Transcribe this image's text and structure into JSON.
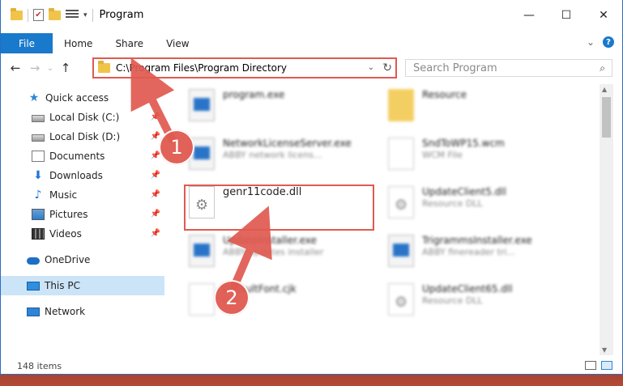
{
  "window": {
    "title": "Program",
    "controls": {
      "minimize": "—",
      "maximize": "☐",
      "close": "✕"
    }
  },
  "ribbon": {
    "tabs": [
      "File",
      "Home",
      "Share",
      "View"
    ],
    "help": "?",
    "expand": "⌄"
  },
  "nav": {
    "back": "←",
    "forward": "→",
    "up": "↑",
    "recent": "⌄",
    "address": "C:\\Program Files\\Program Directory",
    "refresh": "↻",
    "search_placeholder": "Search Program",
    "search_icon": "🔍"
  },
  "sidebar": {
    "items": [
      {
        "label": "Quick access",
        "icon": "star-icon",
        "pinned": false
      },
      {
        "label": "Local Disk (C:)",
        "icon": "drive-icon",
        "pinned": true
      },
      {
        "label": "Local Disk (D:)",
        "icon": "drive-icon",
        "pinned": true
      },
      {
        "label": "Documents",
        "icon": "documents-icon",
        "pinned": true
      },
      {
        "label": "Downloads",
        "icon": "downloads-icon",
        "pinned": true
      },
      {
        "label": "Music",
        "icon": "music-icon",
        "pinned": true
      },
      {
        "label": "Pictures",
        "icon": "pictures-icon",
        "pinned": true
      },
      {
        "label": "Videos",
        "icon": "videos-icon",
        "pinned": true
      },
      {
        "label": "OneDrive",
        "icon": "onedrive-icon",
        "pinned": false
      },
      {
        "label": "This PC",
        "icon": "this-pc-icon",
        "pinned": false,
        "selected": true
      },
      {
        "label": "Network",
        "icon": "network-icon",
        "pinned": false
      }
    ]
  },
  "files": [
    {
      "name": "program.exe",
      "desc": "",
      "icon": "exe-icon"
    },
    {
      "name": "Resource",
      "desc": "",
      "icon": "folder-icon"
    },
    {
      "name": "NetworkLicenseServer.exe",
      "desc": "ABBY network licens...",
      "icon": "exe-icon"
    },
    {
      "name": "SndToWP15.wcm",
      "desc": "WCM File",
      "icon": "document-icon"
    },
    {
      "name": "genr11code.dll",
      "desc": "",
      "icon": "dll-icon"
    },
    {
      "name": "UpdateClient5.dll",
      "desc": "Resource DLL",
      "icon": "dll-icon"
    },
    {
      "name": "UpdateInstaller.exe",
      "desc": "ABBY updates installer",
      "icon": "exe-icon"
    },
    {
      "name": "TrigrammsInstaller.exe",
      "desc": "ABBY finereader tri...",
      "icon": "exe-icon"
    },
    {
      "name": "DefaultFont.cjk",
      "desc": "File",
      "icon": "document-icon"
    },
    {
      "name": "UpdateClient65.dll",
      "desc": "Resource DLL",
      "icon": "dll-icon"
    }
  ],
  "status": {
    "item_count": "148 items"
  },
  "annotations": {
    "step1": "1",
    "step2": "2",
    "color": "#e05a50"
  }
}
